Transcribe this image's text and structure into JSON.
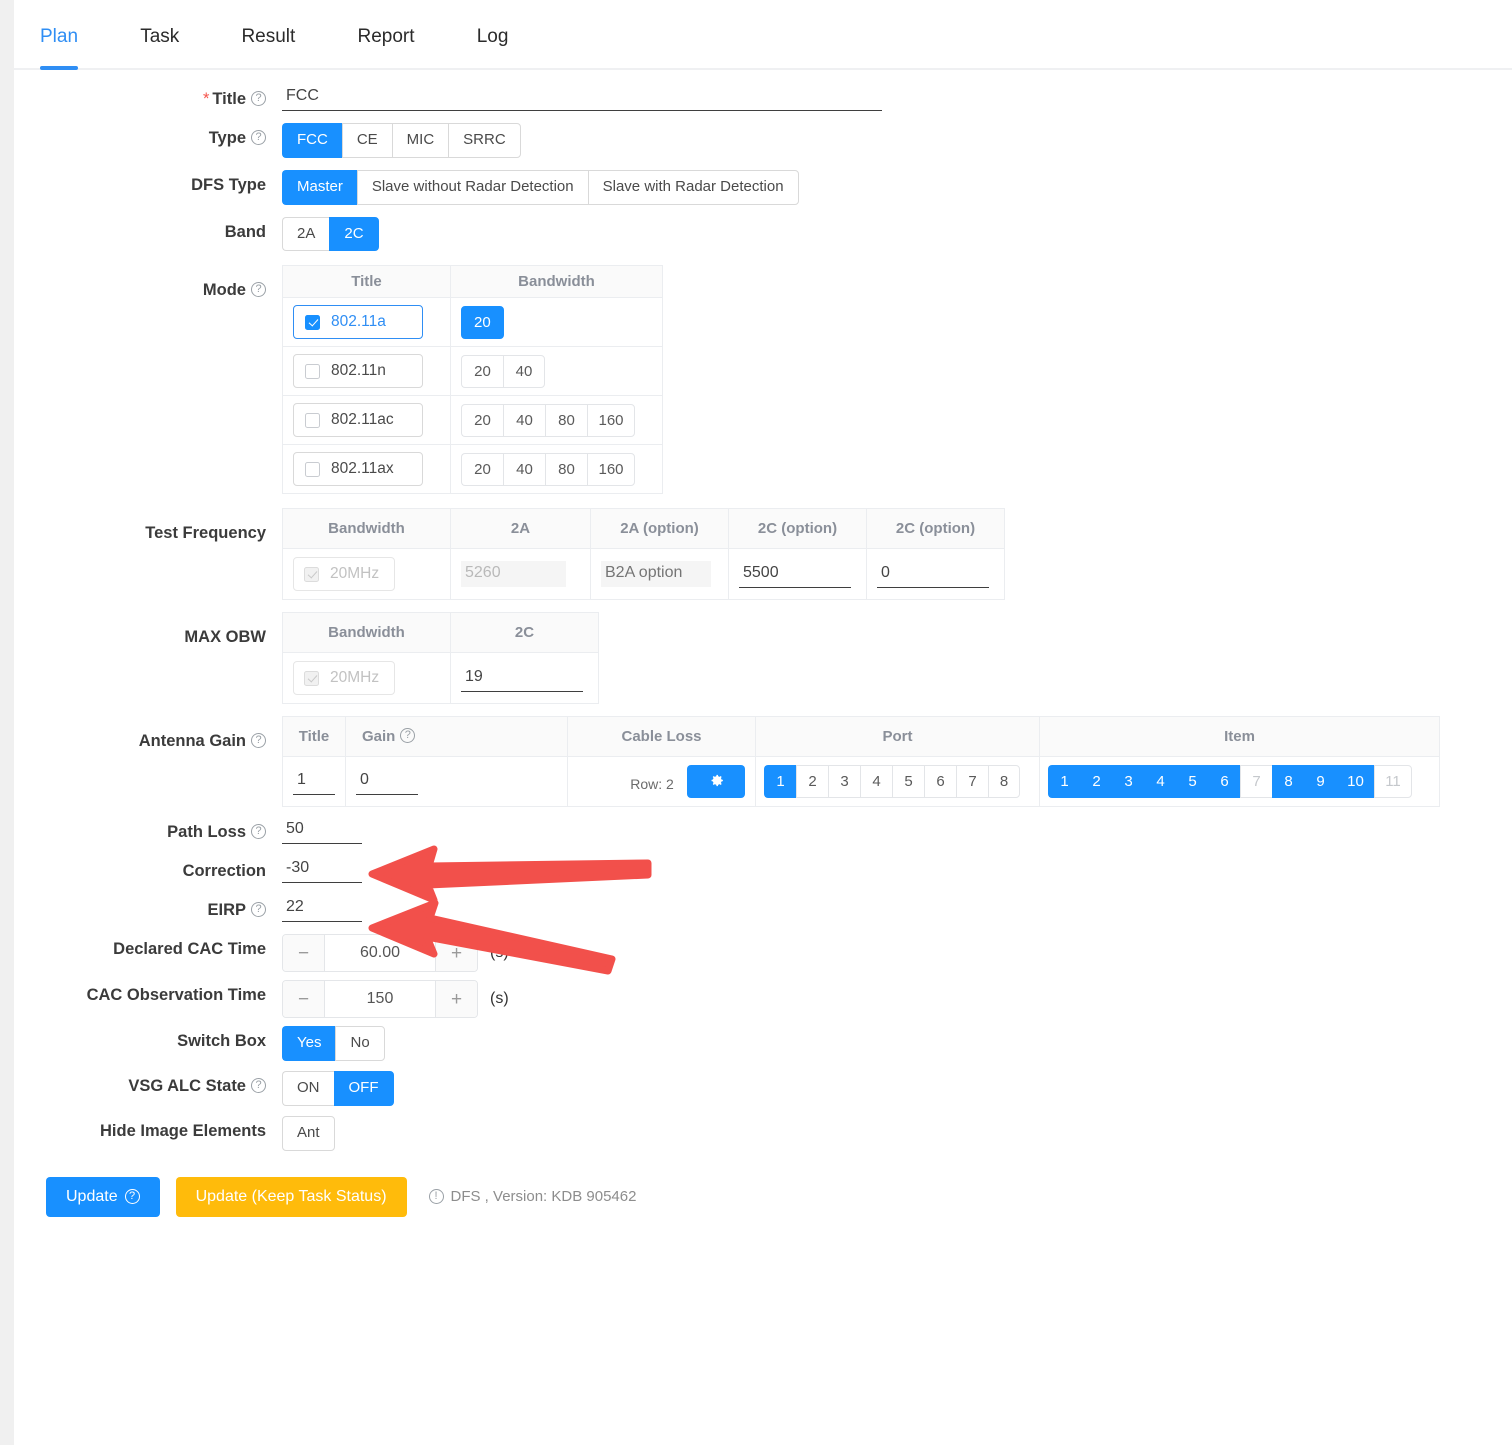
{
  "tabs": [
    {
      "label": "Plan",
      "active": true
    },
    {
      "label": "Task",
      "active": false
    },
    {
      "label": "Result",
      "active": false
    },
    {
      "label": "Report",
      "active": false
    },
    {
      "label": "Log",
      "active": false
    }
  ],
  "form": {
    "title": {
      "label": "Title",
      "required": true,
      "value": "FCC",
      "help": true
    },
    "type": {
      "label": "Type",
      "help": true,
      "options": [
        "FCC",
        "CE",
        "MIC",
        "SRRC"
      ],
      "selected": "FCC"
    },
    "dfs_type": {
      "label": "DFS Type",
      "options": [
        "Master",
        "Slave without Radar Detection",
        "Slave with Radar Detection"
      ],
      "selected": "Master"
    },
    "band": {
      "label": "Band",
      "options": [
        "2A",
        "2C"
      ],
      "selected": "2C"
    },
    "mode": {
      "label": "Mode",
      "help": true,
      "columns": [
        "Title",
        "Bandwidth"
      ],
      "rows": [
        {
          "title": "802.11a",
          "checked": true,
          "bandwidths": [
            "20"
          ],
          "selected_bandwidth": "20"
        },
        {
          "title": "802.11n",
          "checked": false,
          "bandwidths": [
            "20",
            "40"
          ],
          "selected_bandwidth": null
        },
        {
          "title": "802.11ac",
          "checked": false,
          "bandwidths": [
            "20",
            "40",
            "80",
            "160"
          ],
          "selected_bandwidth": null
        },
        {
          "title": "802.11ax",
          "checked": false,
          "bandwidths": [
            "20",
            "40",
            "80",
            "160"
          ],
          "selected_bandwidth": null
        }
      ]
    },
    "test_frequency": {
      "label": "Test Frequency",
      "columns": [
        "Bandwidth",
        "2A",
        "2A (option)",
        "2C (option)",
        "2C (option)"
      ],
      "row": {
        "bandwidth": "20MHz",
        "bandwidth_checked": true,
        "bandwidth_disabled": true,
        "values": [
          {
            "value": "5260",
            "disabled": true,
            "placeholder": ""
          },
          {
            "value": "",
            "disabled": true,
            "placeholder": "B2A option"
          },
          {
            "value": "5500",
            "disabled": false,
            "placeholder": ""
          },
          {
            "value": "0",
            "disabled": false,
            "placeholder": ""
          }
        ]
      }
    },
    "max_obw": {
      "label": "MAX OBW",
      "columns": [
        "Bandwidth",
        "2C"
      ],
      "row": {
        "bandwidth": "20MHz",
        "bandwidth_checked": true,
        "bandwidth_disabled": true,
        "value": "19"
      }
    },
    "antenna_gain": {
      "label": "Antenna Gain",
      "help": true,
      "columns": [
        "Title",
        "Gain",
        "Cable Loss",
        "Port",
        "Item"
      ],
      "gain_help": true,
      "row": {
        "title": "1",
        "gain": "0",
        "cable_loss_row_label": "Row: 2",
        "cable_loss_icon": "gear-icon",
        "ports": [
          {
            "label": "1",
            "state": "on"
          },
          {
            "label": "2",
            "state": "off"
          },
          {
            "label": "3",
            "state": "off"
          },
          {
            "label": "4",
            "state": "off"
          },
          {
            "label": "5",
            "state": "off"
          },
          {
            "label": "6",
            "state": "off"
          },
          {
            "label": "7",
            "state": "off"
          },
          {
            "label": "8",
            "state": "off"
          }
        ],
        "items": [
          {
            "label": "1",
            "state": "on"
          },
          {
            "label": "2",
            "state": "on"
          },
          {
            "label": "3",
            "state": "on"
          },
          {
            "label": "4",
            "state": "on"
          },
          {
            "label": "5",
            "state": "on"
          },
          {
            "label": "6",
            "state": "on"
          },
          {
            "label": "7",
            "state": "dis"
          },
          {
            "label": "8",
            "state": "on"
          },
          {
            "label": "9",
            "state": "on"
          },
          {
            "label": "10",
            "state": "on"
          },
          {
            "label": "11",
            "state": "dis"
          }
        ]
      }
    },
    "path_loss": {
      "label": "Path Loss",
      "help": true,
      "value": "50"
    },
    "correction": {
      "label": "Correction",
      "help": false,
      "value": "-30"
    },
    "eirp": {
      "label": "EIRP",
      "help": true,
      "value": "22"
    },
    "declared_cac_time": {
      "label": "Declared CAC Time",
      "value": "60.00",
      "unit": "(s)",
      "minus": "−",
      "plus": "+"
    },
    "cac_observation_time": {
      "label": "CAC Observation Time",
      "value": "150",
      "unit": "(s)",
      "minus": "−",
      "plus": "+"
    },
    "switch_box": {
      "label": "Switch Box",
      "options": [
        "Yes",
        "No"
      ],
      "selected": "Yes"
    },
    "vsg_alc_state": {
      "label": "VSG ALC State",
      "help": true,
      "options": [
        "ON",
        "OFF"
      ],
      "selected": "OFF"
    },
    "hide_image_elements": {
      "label": "Hide Image Elements",
      "options": [
        "Ant"
      ],
      "selected": null
    }
  },
  "footer": {
    "update_label": "Update",
    "update_keep_label": "Update (Keep Task Status)",
    "version_text": "DFS , Version: KDB 905462"
  },
  "annotations": {
    "arrow_color": "#f2504b",
    "arrows": [
      {
        "name": "path-loss-arrow",
        "target": "path_loss"
      },
      {
        "name": "correction-arrow",
        "target": "correction"
      }
    ]
  },
  "colors": {
    "accent_blue": "#1890ff",
    "tab_blue": "#2f8ef4",
    "warn_yellow": "#ffbb0b",
    "required_red": "#f5544c",
    "arrow_red": "#f2504b"
  }
}
